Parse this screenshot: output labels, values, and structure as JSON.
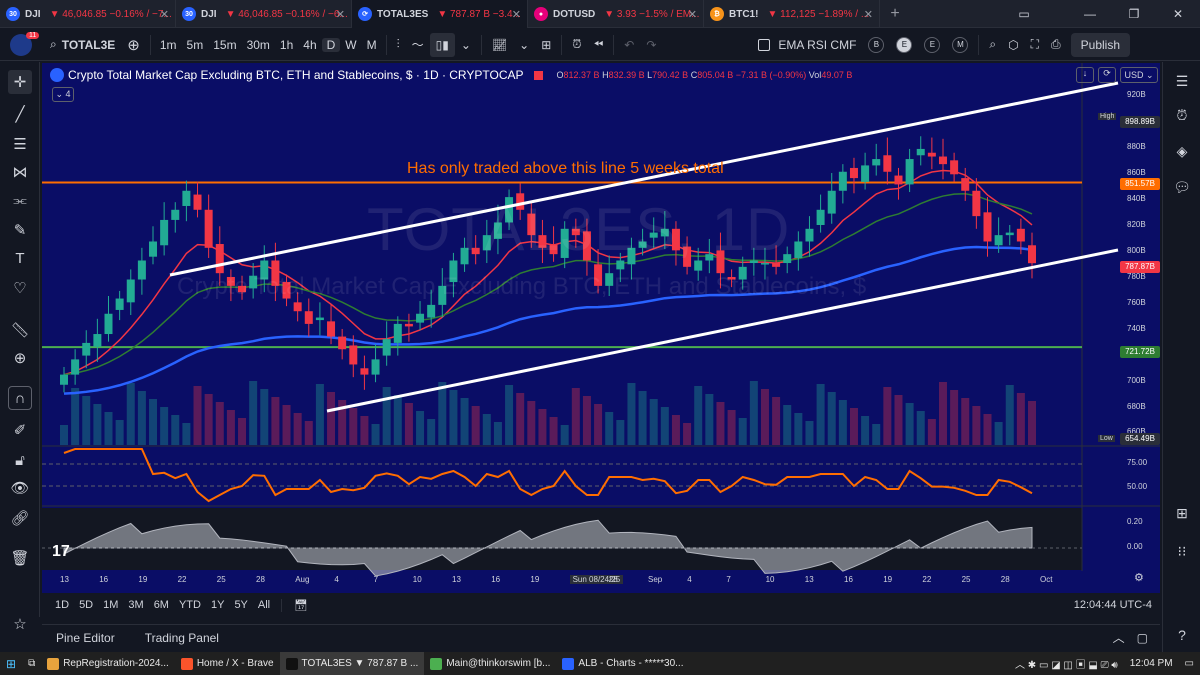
{
  "browser_tabs": [
    {
      "symbol": "DJI",
      "change": "▼ 46,046.85 −0.16% / −7...",
      "badge": "30",
      "color": "#2962ff"
    },
    {
      "symbol": "DJI",
      "change": "▼ 46,046.85 −0.16% / −6...",
      "badge": "30",
      "color": "#2962ff"
    },
    {
      "symbol": "TOTAL3ES",
      "change": "▼ 787.87 B −3.4...",
      "badge": "",
      "color": "#2962ff",
      "active": true
    },
    {
      "symbol": "DOTUSD",
      "change": "▼ 3.93 −1.5% / EM...",
      "badge": "",
      "color": "#e6007a"
    },
    {
      "symbol": "BTC1!",
      "change": "▼ 112,125 −1.89% / ...",
      "badge": "",
      "color": "#f7931a"
    }
  ],
  "toolbar": {
    "avatar_badge": "11",
    "symbol": "TOTAL3E",
    "timeframes": [
      "1m",
      "5m",
      "15m",
      "30m",
      "1h",
      "4h",
      "D",
      "W",
      "M"
    ],
    "selected_timeframe": "D",
    "indicators_label": "EMA RSI CMF",
    "alerts": [
      "B",
      "E",
      "E",
      "M"
    ],
    "publish_label": "Publish"
  },
  "chart": {
    "title": "Crypto Total Market Cap Excluding BTC, ETH and Stablecoins, $ · 1D · CRYPTOCAP",
    "ohlc": {
      "o_label": "O",
      "o": "812.37 B",
      "h_label": "H",
      "h": "832.39 B",
      "l_label": "L",
      "l": "790.42 B",
      "c_label": "C",
      "c": "805.04 B",
      "change": "−7.31 B (−0.90%)",
      "vol_label": "Vol",
      "vol": "49.07 B"
    },
    "indicator_count": "4",
    "watermark_symbol": "TOTAL3ES, 1D",
    "watermark_desc": "Crypto Total Market Cap Excluding BTC, ETH and Stablecoins, $",
    "annotation": "Has only traded above this line 5 weeks total",
    "currency": "USD",
    "price_ticks": [
      "920B",
      "880B",
      "860B",
      "840B",
      "820B",
      "800B",
      "780B",
      "760B",
      "740B",
      "700B",
      "680B",
      "660B"
    ],
    "high_label": "High",
    "high_value": "898.89B",
    "resistance_value": "851.57B",
    "last_value": "787.87B",
    "support_value": "721.72B",
    "low_label": "Low",
    "low_value": "654.49B",
    "rsi_ticks": [
      "75.00",
      "50.00"
    ],
    "cmf_ticks": [
      "0.20",
      "0.00"
    ],
    "time_ticks": [
      "13",
      "16",
      "19",
      "22",
      "25",
      "28",
      "Aug",
      "4",
      "7",
      "10",
      "13",
      "16",
      "19",
      "Sun 08/24/25",
      "28",
      "Sep",
      "4",
      "7",
      "10",
      "13",
      "16",
      "19",
      "22",
      "25",
      "28",
      "Oct"
    ],
    "colors": {
      "up": "#22ab94",
      "down": "#f23645",
      "resistance": "#ff6d00",
      "support": "#4caf50",
      "ema_fast": "#f23645",
      "ema_mid": "#2e7d32",
      "ema_slow": "#2962ff",
      "bg": "#0a0d66"
    }
  },
  "chart_data": {
    "type": "candlestick",
    "title": "Crypto Total Market Cap Excluding BTC, ETH and Stablecoins, $ · 1D · CRYPTOCAP",
    "x_range": [
      "Jul 13",
      "Sep 25"
    ],
    "y_unit": "B USD",
    "ylim": [
      650,
      930
    ],
    "horizontal_lines": [
      {
        "value": 851.57,
        "color": "#ff6d00"
      },
      {
        "value": 721.72,
        "color": "#4caf50"
      }
    ],
    "close_approx": [
      700,
      712,
      725,
      732,
      748,
      760,
      775,
      790,
      805,
      822,
      830,
      845,
      830,
      800,
      780,
      770,
      765,
      778,
      790,
      770,
      760,
      750,
      740,
      745,
      730,
      720,
      708,
      700,
      712,
      728,
      740,
      738,
      748,
      755,
      770,
      790,
      800,
      795,
      810,
      820,
      840,
      830,
      810,
      800,
      795,
      815,
      810,
      790,
      770,
      780,
      790,
      800,
      805,
      812,
      815,
      798,
      785,
      790,
      795,
      780,
      775,
      785,
      790,
      788,
      785,
      795,
      805,
      815,
      830,
      845,
      860,
      855,
      865,
      870,
      860,
      850,
      870,
      878,
      872,
      866,
      858,
      845,
      825,
      805,
      810,
      812,
      805,
      787.87
    ]
  },
  "range_bar": {
    "ranges": [
      "1D",
      "5D",
      "1M",
      "3M",
      "6M",
      "YTD",
      "1Y",
      "5Y",
      "All"
    ],
    "clock": "12:04:44 UTC-4"
  },
  "bottom_panel": {
    "pine_editor": "Pine Editor",
    "trading_panel": "Trading Panel"
  },
  "taskbar": {
    "items": [
      "RepRegistration-2024...",
      "Home / X - Brave",
      "TOTAL3ES ▼ 787.87 B ...",
      "Main@thinkorswim [b...",
      "ALB - Charts - *****30..."
    ],
    "time": "12:04 PM"
  }
}
